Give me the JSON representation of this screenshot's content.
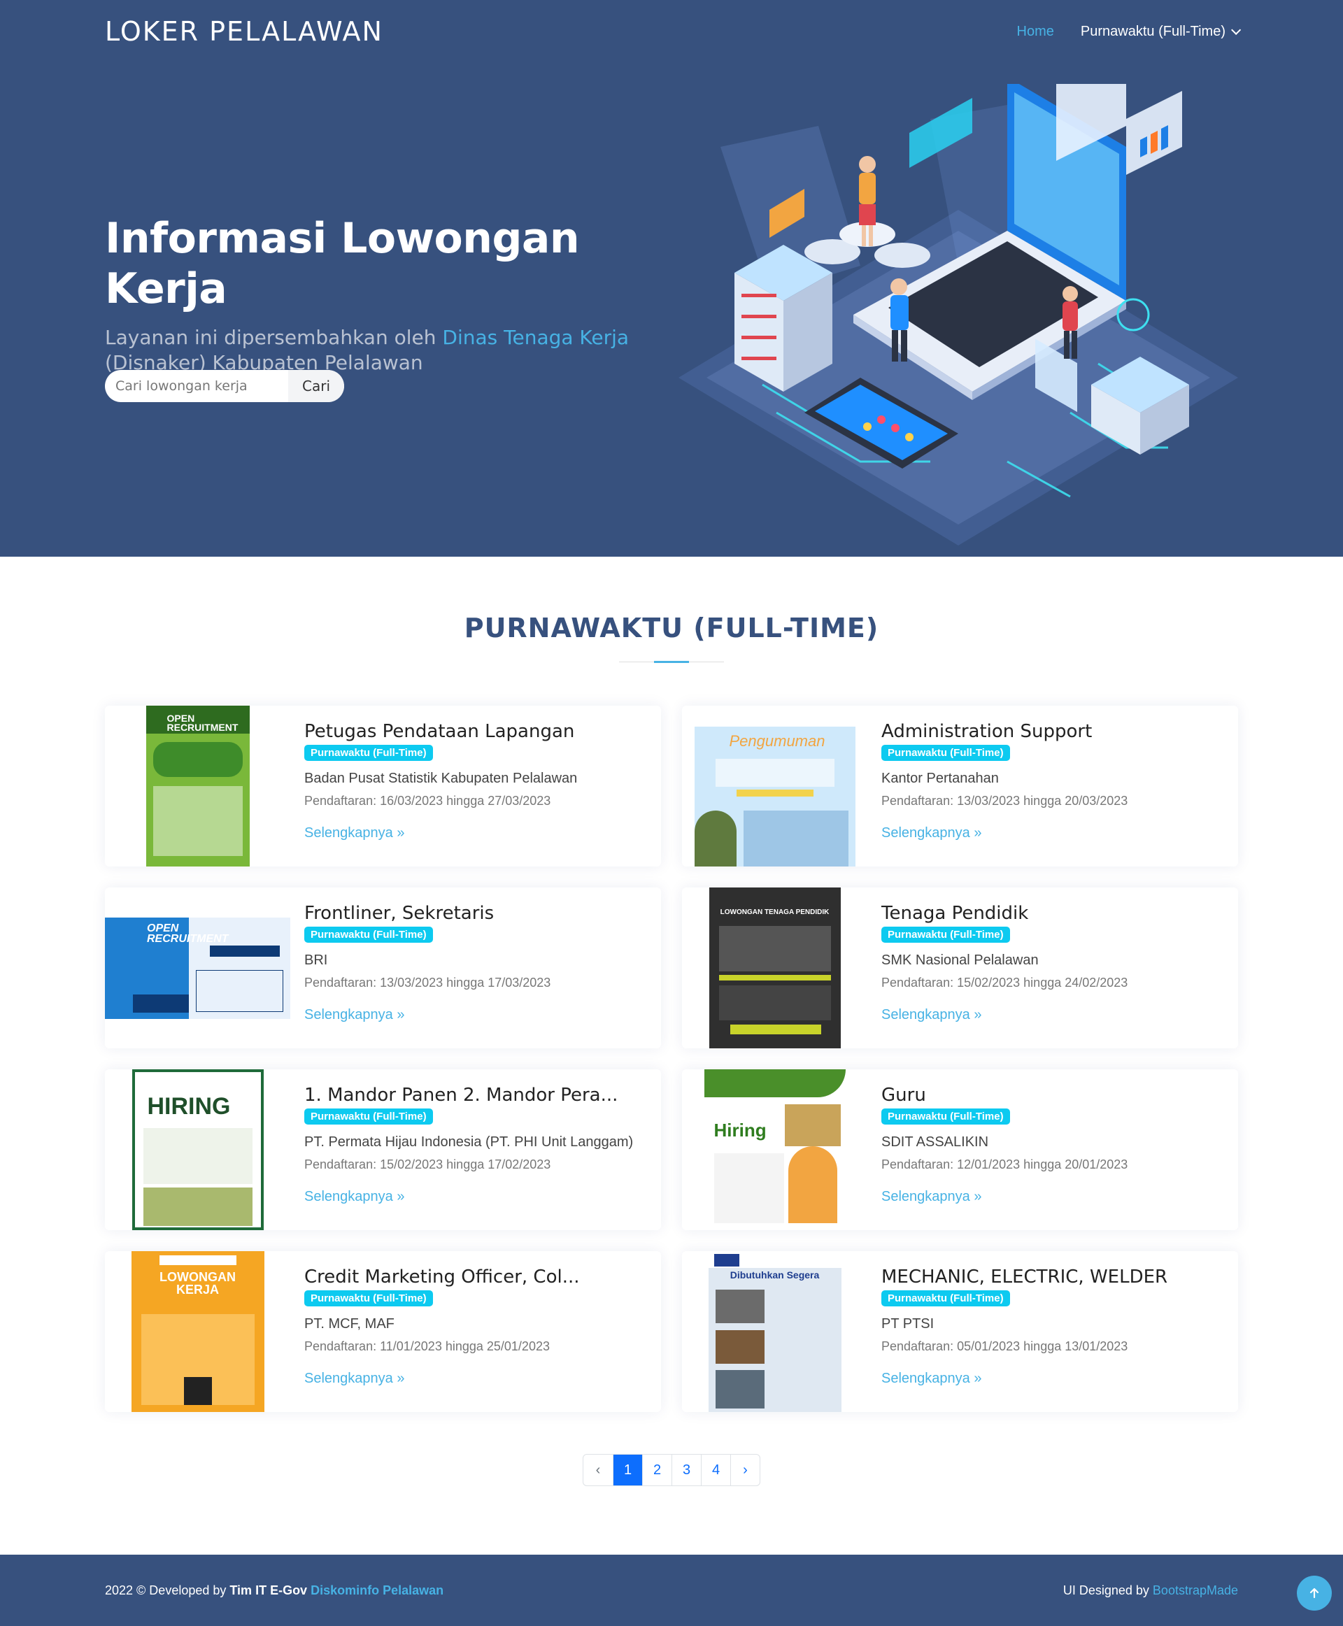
{
  "header": {
    "logo": "LOKER PELALAWAN",
    "nav": {
      "home": "Home",
      "dropdown": "Purnawaktu (Full-Time)"
    }
  },
  "hero": {
    "title": "Informasi Lowongan Kerja",
    "subtitle_pre": "Layanan ini dipersembahkan oleh ",
    "subtitle_highlight": "Dinas Tenaga Kerja",
    "subtitle_post": "(Disnaker) Kabupaten Pelalawan",
    "search_placeholder": "Cari lowongan kerja",
    "search_button": "Cari"
  },
  "section": {
    "title": "PURNAWAKTU (FULL-TIME)"
  },
  "jobs": [
    {
      "title": "Petugas Pendataan Lapangan",
      "badge": "Purnawaktu (Full-Time)",
      "company": "Badan Pusat Statistik Kabupaten Pelalawan",
      "period": "Pendaftaran: 16/03/2023 hingga 27/03/2023",
      "link": "Selengkapnya »",
      "poster_text": "OPEN RECRUITMENT"
    },
    {
      "title": "Administration Support",
      "badge": "Purnawaktu (Full-Time)",
      "company": "Kantor Pertanahan",
      "period": "Pendaftaran: 13/03/2023 hingga 20/03/2023",
      "link": "Selengkapnya »",
      "poster_text": "Pengumuman"
    },
    {
      "title": "Frontliner, Sekretaris",
      "badge": "Purnawaktu (Full-Time)",
      "company": "BRI",
      "period": "Pendaftaran: 13/03/2023 hingga 17/03/2023",
      "link": "Selengkapnya »",
      "poster_text": "OPEN RECRUITMENT"
    },
    {
      "title": "Tenaga Pendidik",
      "badge": "Purnawaktu (Full-Time)",
      "company": "SMK Nasional Pelalawan",
      "period": "Pendaftaran: 15/02/2023 hingga 24/02/2023",
      "link": "Selengkapnya »",
      "poster_text": "LOWONGAN TENAGA PENDIDIK"
    },
    {
      "title": "1. Mandor Panen 2. Mandor Pera...",
      "badge": "Purnawaktu (Full-Time)",
      "company": "PT. Permata Hijau Indonesia (PT. PHI Unit Langgam)",
      "period": "Pendaftaran: 15/02/2023 hingga 17/02/2023",
      "link": "Selengkapnya »",
      "poster_text": "HIRING"
    },
    {
      "title": "Guru",
      "badge": "Purnawaktu (Full-Time)",
      "company": "SDIT ASSALIKIN",
      "period": "Pendaftaran: 12/01/2023 hingga 20/01/2023",
      "link": "Selengkapnya »",
      "poster_text": "Hiring"
    },
    {
      "title": "Credit Marketing Officer, Col...",
      "badge": "Purnawaktu (Full-Time)",
      "company": "PT. MCF, MAF",
      "period": "Pendaftaran: 11/01/2023 hingga 25/01/2023",
      "link": "Selengkapnya »",
      "poster_text": "LOWONGAN KERJA"
    },
    {
      "title": "MECHANIC, ELECTRIC, WELDER",
      "badge": "Purnawaktu (Full-Time)",
      "company": "PT PTSI",
      "period": "Pendaftaran: 05/01/2023 hingga 13/01/2023",
      "link": "Selengkapnya »",
      "poster_text": "Dibutuhkan Segera"
    }
  ],
  "pagination": {
    "prev": "‹",
    "pages": [
      "1",
      "2",
      "3",
      "4"
    ],
    "active": "1",
    "next": "›"
  },
  "footer": {
    "left_pre": "2022 © Developed by ",
    "left_team": "Tim IT E-Gov",
    "left_link": "Diskominfo Pelalawan",
    "right_pre": "UI Designed by ",
    "right_link": "BootstrapMade"
  },
  "colors": {
    "primary": "#37517e",
    "accent": "#47b2e4",
    "badge": "#0dcaf0"
  }
}
